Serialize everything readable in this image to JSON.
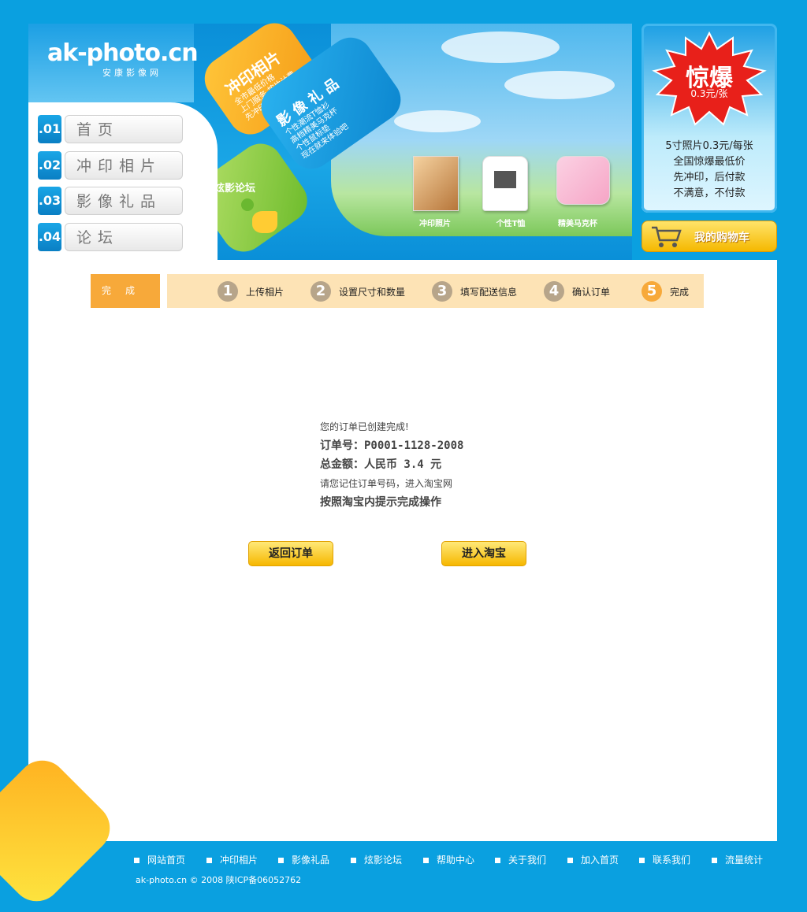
{
  "header": {
    "logo": "ak-photo.cn",
    "logo_sub": "安康影像网",
    "tags": {
      "orange_title": "冲印相片",
      "orange_lines": [
        "全市最低价格",
        "上门服务 按片计费",
        "先冲印 后付款"
      ],
      "blue_title": "影 像 礼 品",
      "blue_lines": [
        "个性潮流T恤衫",
        "高档精美马克杯",
        "个性鼠标垫",
        "现在就来体验吧"
      ],
      "green_title": "炫影论坛"
    },
    "products": [
      {
        "caption": "冲印照片"
      },
      {
        "caption": "个性T恤"
      },
      {
        "caption": "精美马克杯"
      }
    ]
  },
  "nav": {
    "items": [
      {
        "num": ".01",
        "label": "首页"
      },
      {
        "num": ".02",
        "label": "冲印相片"
      },
      {
        "num": ".03",
        "label": "影像礼品"
      },
      {
        "num": ".04",
        "label": "论坛"
      }
    ]
  },
  "promo": {
    "burst_title": "惊爆",
    "burst_price": "0.3元/张",
    "lines": [
      "5寸照片0.3元/每张",
      "全国惊爆最低价",
      "先冲印，后付款",
      "不满意，不付款"
    ],
    "cart_label": "我的购物车"
  },
  "steps": {
    "current_tab": "完成",
    "items": [
      {
        "num": "1",
        "label": "上传相片"
      },
      {
        "num": "2",
        "label": "设置尺寸和数量"
      },
      {
        "num": "3",
        "label": "填写配送信息"
      },
      {
        "num": "4",
        "label": "确认订单"
      },
      {
        "num": "5",
        "label": "完成"
      }
    ]
  },
  "message": {
    "line1": "您的订单已创建完成!",
    "order_no": "订单号：P0001-1128-2008",
    "total": "总金额：人民币 3.4 元",
    "line4": "请您记住订单号码，进入淘宝网",
    "line5": "按照淘宝内提示完成操作"
  },
  "buttons": {
    "back": "返回订单",
    "taobao": "进入淘宝"
  },
  "footer": {
    "links": [
      "网站首页",
      "冲印相片",
      "影像礼品",
      "炫影论坛",
      "帮助中心",
      "关于我们",
      "加入首页",
      "联系我们",
      "流量统计"
    ],
    "copyright": "ak-photo.cn © 2008  陕ICP备06052762"
  },
  "colors": {
    "page_bg": "#0aa0e0",
    "accent_orange": "#f7a93a",
    "steps_bg": "#fde3b5",
    "button_yellow": "#f6b700"
  }
}
